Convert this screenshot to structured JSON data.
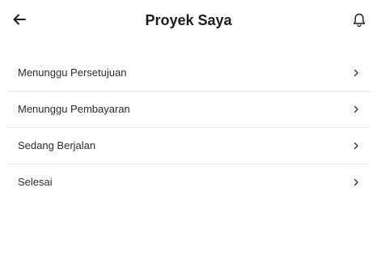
{
  "header": {
    "title": "Proyek Saya",
    "back_icon": "arrow-left-icon",
    "notification_icon": "bell-icon"
  },
  "menu": {
    "items": [
      {
        "label": "Menunggu Persetujuan",
        "icon": "chevron-right-icon"
      },
      {
        "label": "Menunggu Pembayaran",
        "icon": "chevron-right-icon"
      },
      {
        "label": "Sedang Berjalan",
        "icon": "chevron-right-icon"
      },
      {
        "label": "Selesai",
        "icon": "chevron-right-icon"
      }
    ]
  },
  "colors": {
    "text": "#1f2024",
    "divider": "#e3e4e7",
    "background": "#ffffff"
  }
}
